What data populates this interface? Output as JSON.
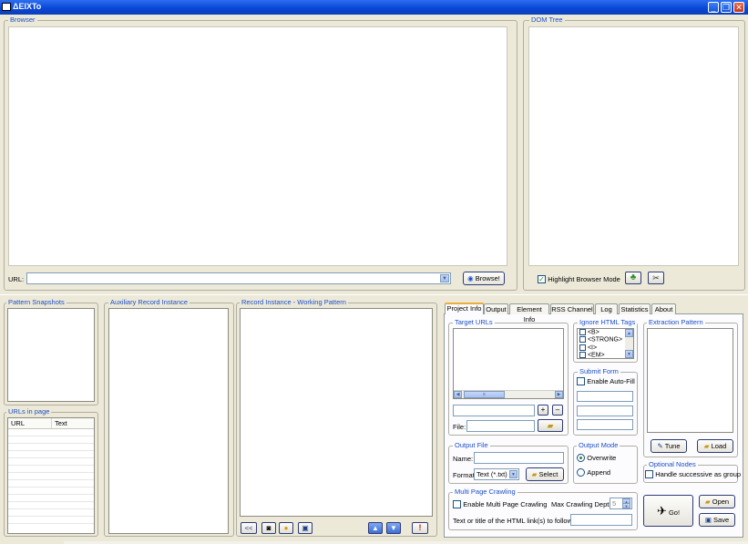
{
  "window": {
    "title": "ΔEIXTo",
    "min": "_",
    "max": "❐",
    "close": "✕"
  },
  "browser": {
    "label": "Browser",
    "url_label": "URL:",
    "url_value": "",
    "browse_button": "Browse!"
  },
  "dom_tree": {
    "label": "DOM Tree",
    "highlight_label": "Highlight Browser Mode",
    "highlight_checked": true
  },
  "pattern_snapshots": {
    "label": "Pattern Snapshots"
  },
  "urls_in_page": {
    "label": "URLs in page",
    "columns": [
      "URL",
      "Text"
    ]
  },
  "auxiliary": {
    "label": "Auxiliary Record Instance"
  },
  "record_instance": {
    "label": "Record Instance - Working Pattern",
    "first_button": "<<",
    "warning_button": "!"
  },
  "tabs": [
    "Project Info",
    "Output",
    "Element Info",
    "RSS Channel",
    "Log",
    "Statistics",
    "About"
  ],
  "project_info": {
    "target_urls_label": "Target URLs",
    "add_button": "+",
    "remove_button": "–",
    "file_label": "File:",
    "ignore_tags_label": "Ignore HTML Tags",
    "ignore_tags": [
      "<B>",
      "<STRONG>",
      "<I>",
      "<EM>"
    ],
    "submit_form_label": "Submit Form",
    "enable_autofill_label": "Enable Auto-Fill",
    "extraction_pattern_label": "Extraction Pattern",
    "tune_button": "Tune",
    "load_button": "Load",
    "output_file_label": "Output File",
    "name_label": "Name:",
    "format_label": "Format:",
    "format_value": "Text (*.txt)",
    "select_button": "Select",
    "output_mode_label": "Output Mode",
    "overwrite_label": "Overwrite",
    "append_label": "Append",
    "optional_nodes_label": "Optional Nodes",
    "handle_successive_label": "Handle successive as group",
    "multi_page_label": "Multi Page Crawling",
    "enable_multi_label": "Enable Multi Page Crawling",
    "max_depth_label": "Max Crawling Depth:",
    "max_depth_value": "5",
    "follow_text_label": "Text or title of the HTML link(s) to follow:",
    "go_button": "Go!",
    "open_button": "Open",
    "save_button": "Save"
  },
  "colors": {
    "titlebar": "#0a48d8",
    "group_label": "#1b4fc9",
    "panel": "#ece9d8"
  }
}
